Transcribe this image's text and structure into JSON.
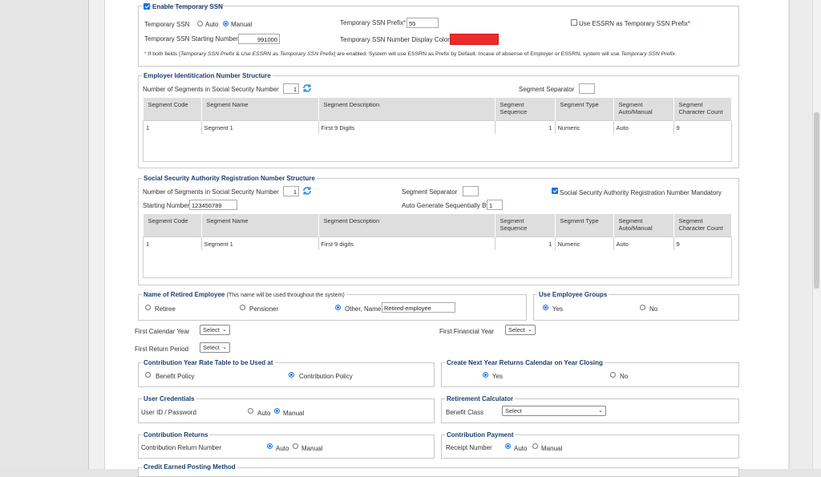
{
  "temporary_ssn": {
    "enable_label": "Enable Temporary SSN",
    "enabled": true,
    "ssn_label": "Temporary SSN",
    "auto_label": "Auto",
    "manual_label": "Manual",
    "selected": "Manual",
    "prefix_label": "Temporary SSN Prefix",
    "prefix_value": "55",
    "use_essrn_label": "Use ESSRN as Temporary SSN Prefix",
    "use_essrn_checked": false,
    "starting_number_label": "Temporary SSN Starting Number",
    "starting_number_value": "991000",
    "display_color_label": "Temporary SSN Number Display Color",
    "display_color": "#ee2a2a",
    "note_star": "*",
    "note_parts": [
      "If both fields [",
      "Temporary SSN Prefix",
      " & ",
      "Use ESSRN as Temporary SSN Prefix",
      "] are enabled. System will use ESSRN as Prefix by Default. Incase of absense of Employer or ESSRN, system will use ",
      "Temporary SSN Prefix",
      "."
    ]
  },
  "ein_structure": {
    "title": "Employer Identitication Number Structure",
    "segments_label": "Number of Segments in Social Security Number",
    "segments_value": "1",
    "separator_label": "Segment Separator",
    "separator_value": "",
    "headers": [
      "Segment Code",
      "Segment Name",
      "Segment Description",
      "Segment Sequence",
      "Segment Type",
      "Segment Auto/Manual",
      "Segment Character Count"
    ],
    "row": [
      "1",
      "Segment 1",
      "First 9 Digits",
      "1",
      "Numeric",
      "Auto",
      "9"
    ]
  },
  "ssa_structure": {
    "title": "Social Security Authority Registration Number Structure",
    "segments_label": "Number of Segments in Social Security Number",
    "segments_value": "1",
    "separator_label": "Segment Separator",
    "separator_value": "",
    "mandatory_label": "Social Security Authority Registration Number Mandatory",
    "mandatory_checked": true,
    "starting_number_label": "Starting Number",
    "starting_number_value": "123456789",
    "auto_generate_label": "Auto Generate Sequentially By",
    "auto_generate_value": "1",
    "headers": [
      "Segment Code",
      "Segment Name",
      "Segment Description",
      "Segment Sequence",
      "Segment Type",
      "Segment Auto/Manual",
      "Segment Character Count"
    ],
    "row": [
      "1",
      "Segment 1",
      "First 9 digits",
      "1",
      "Numeric",
      "Auto",
      "9"
    ]
  },
  "retired_name": {
    "title": "Name of Retired Employee",
    "note": "(This name will be used throughout the system)",
    "options": [
      "Retiree",
      "Pensioner",
      "Other, Name"
    ],
    "selected": "Other, Name",
    "other_value": "Retired employee"
  },
  "employee_groups": {
    "title": "Use Employee Groups",
    "yes": "Yes",
    "no": "No",
    "selected": "Yes"
  },
  "calendar": {
    "first_calendar_year_label": "First Calendar Year",
    "first_calendar_year_value": "Select",
    "first_financial_year_label": "First Financial Year",
    "first_financial_year_value": "Select",
    "first_return_period_label": "First Return Period",
    "first_return_period_value": "Select"
  },
  "rate_table": {
    "title": "Contribution Year Rate Table to be Used at",
    "options": [
      "Benefit Policy",
      "Contribution Policy"
    ],
    "selected": "Contribution Policy"
  },
  "next_year_calendar": {
    "title": "Create Next Year Returns Calendar on Year Closing",
    "yes": "Yes",
    "no": "No",
    "selected": "Yes"
  },
  "user_credentials": {
    "title": "User Credentials",
    "label": "User ID / Password",
    "auto": "Auto",
    "manual": "Manual",
    "selected": "Manual"
  },
  "retirement_calculator": {
    "title": "Retirement Calculator",
    "label": "Benefit Class",
    "value": "Select"
  },
  "contribution_returns": {
    "title": "Contribution Returns",
    "label": "Contribution Return Number",
    "auto": "Auto",
    "manual": "Manual",
    "selected": "Auto"
  },
  "contribution_payment": {
    "title": "Contribution Payment",
    "label": "Receipt Number",
    "auto": "Auto",
    "manual": "Manual",
    "selected": "Auto"
  },
  "credit_posting": {
    "title": "Credit Earned Posting Method"
  },
  "icons": {
    "refresh": "refresh-icon",
    "chevron": "chevron-down-icon"
  }
}
